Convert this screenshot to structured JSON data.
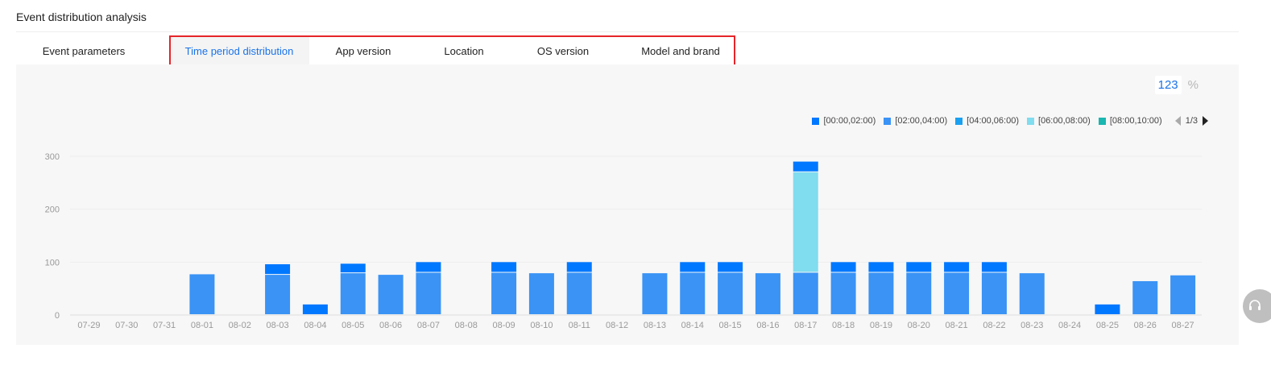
{
  "page": {
    "section_title": "Event distribution analysis"
  },
  "tabs": [
    {
      "label": "Event parameters"
    },
    {
      "label": "Time period distribution"
    },
    {
      "label": "App version"
    },
    {
      "label": "Location"
    },
    {
      "label": "OS version"
    },
    {
      "label": "Model and brand"
    }
  ],
  "display_toggle": {
    "value_label": "123",
    "percent_label": "%"
  },
  "legend_pager": {
    "page": "1/3"
  },
  "colors": {
    "accent": "#1a73e8",
    "highlight_border": "#e5252a",
    "series": [
      "#0078ff",
      "#3a93f5",
      "#1aa0f0",
      "#80dcef",
      "#1ab6b0"
    ]
  },
  "chart_data": {
    "type": "bar",
    "stacked": true,
    "categories": [
      "07-29",
      "07-30",
      "07-31",
      "08-01",
      "08-02",
      "08-03",
      "08-04",
      "08-05",
      "08-06",
      "08-07",
      "08-08",
      "08-09",
      "08-10",
      "08-11",
      "08-12",
      "08-13",
      "08-14",
      "08-15",
      "08-16",
      "08-17",
      "08-18",
      "08-19",
      "08-20",
      "08-21",
      "08-22",
      "08-23",
      "08-24",
      "08-25",
      "08-26",
      "08-27"
    ],
    "series": [
      {
        "name": "[00:00,02:00)",
        "values": [
          0,
          0,
          0,
          0,
          0,
          20,
          20,
          18,
          0,
          20,
          0,
          20,
          0,
          20,
          0,
          0,
          20,
          20,
          0,
          20,
          20,
          20,
          20,
          20,
          20,
          0,
          0,
          20,
          0,
          0
        ]
      },
      {
        "name": "[02:00,04:00)",
        "values": [
          0,
          0,
          0,
          77,
          0,
          76,
          0,
          79,
          76,
          80,
          0,
          80,
          79,
          80,
          0,
          79,
          80,
          80,
          79,
          80,
          80,
          80,
          80,
          80,
          80,
          79,
          0,
          0,
          64,
          75
        ]
      },
      {
        "name": "[04:00,06:00)",
        "values": [
          0,
          0,
          0,
          0,
          0,
          0,
          0,
          0,
          0,
          0,
          0,
          0,
          0,
          0,
          0,
          0,
          0,
          0,
          0,
          0,
          0,
          0,
          0,
          0,
          0,
          0,
          0,
          0,
          0,
          0
        ]
      },
      {
        "name": "[06:00,08:00)",
        "values": [
          0,
          0,
          0,
          0,
          0,
          0,
          0,
          0,
          0,
          0,
          0,
          0,
          0,
          0,
          0,
          0,
          0,
          0,
          0,
          190,
          0,
          0,
          0,
          0,
          0,
          0,
          0,
          0,
          0,
          0
        ]
      },
      {
        "name": "[08:00,10:00)",
        "values": [
          0,
          0,
          0,
          0,
          0,
          0,
          0,
          0,
          0,
          0,
          0,
          0,
          0,
          0,
          0,
          0,
          0,
          0,
          0,
          0,
          0,
          0,
          0,
          0,
          0,
          0,
          0,
          0,
          0,
          0
        ]
      }
    ],
    "stack_order": [
      1,
      2,
      3,
      4,
      0
    ],
    "yticks": [
      0,
      100,
      200,
      300
    ],
    "ylim": [
      0,
      300
    ],
    "grid": true,
    "legend_position": "top-right"
  }
}
